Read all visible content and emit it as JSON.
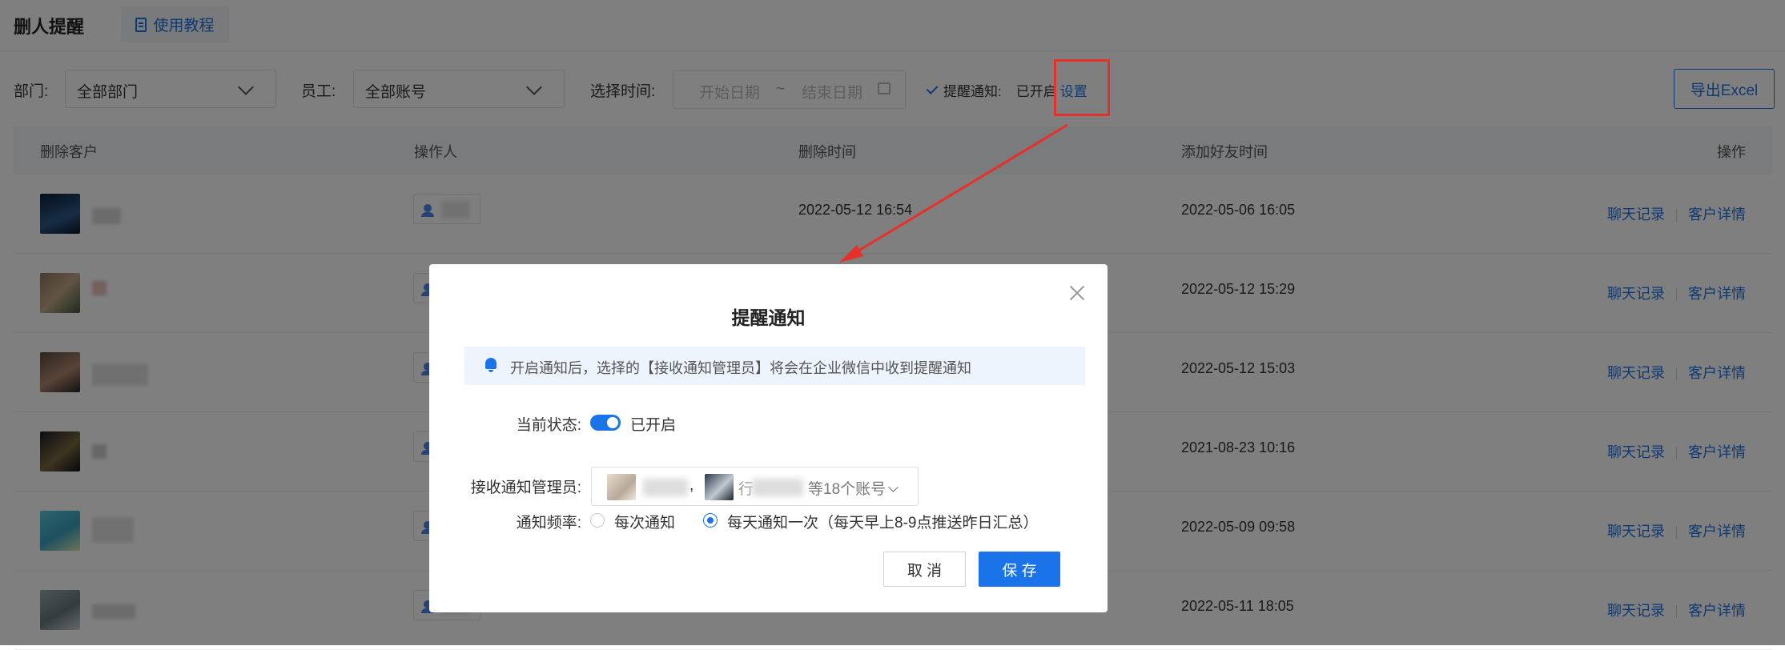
{
  "header": {
    "title": "删人提醒",
    "tutorial_label": "使用教程"
  },
  "filters": {
    "dept_label": "部门:",
    "dept_value": "全部部门",
    "staff_label": "员工:",
    "staff_value": "全部账号",
    "time_label": "选择时间:",
    "start_placeholder": "开始日期",
    "tilde": "~",
    "end_placeholder": "结束日期",
    "notify_label": "提醒通知:",
    "notify_state": "已开启",
    "notify_setting": "设置",
    "export_label": "导出Excel"
  },
  "table": {
    "headers": [
      "删除客户",
      "操作人",
      "删除时间",
      "添加好友时间",
      "操作"
    ],
    "rows": [
      {
        "delete_time": "2022-05-12 16:54",
        "add_time": "2022-05-06 16:05"
      },
      {
        "delete_time": "",
        "add_time": "2022-05-12 15:29"
      },
      {
        "delete_time": "",
        "add_time": "2022-05-12 15:03"
      },
      {
        "delete_time": "",
        "add_time": "2021-08-23 10:16"
      },
      {
        "delete_time": "",
        "add_time": "2022-05-09 09:58"
      },
      {
        "delete_time": "",
        "add_time": "2022-05-11 18:05"
      }
    ],
    "action_chat": "聊天记录",
    "action_detail": "客户详情"
  },
  "modal": {
    "title": "提醒通知",
    "info": "开启通知后，选择的【接收通知管理员】将会在企业微信中收到提醒通知",
    "status_label": "当前状态:",
    "status_value": "已开启",
    "admin_label": "接收通知管理员:",
    "admin_separator": ",",
    "admin_glyph": "行",
    "admin_count": "等18个账号",
    "freq_label": "通知频率:",
    "freq_option1": "每次通知",
    "freq_option2": "每天通知一次（每天早上8-9点推送昨日汇总）",
    "cancel_label": "取 消",
    "save_label": "保 存"
  },
  "colors": {
    "accent": "#1a73e8",
    "annotation": "#e8302b"
  }
}
